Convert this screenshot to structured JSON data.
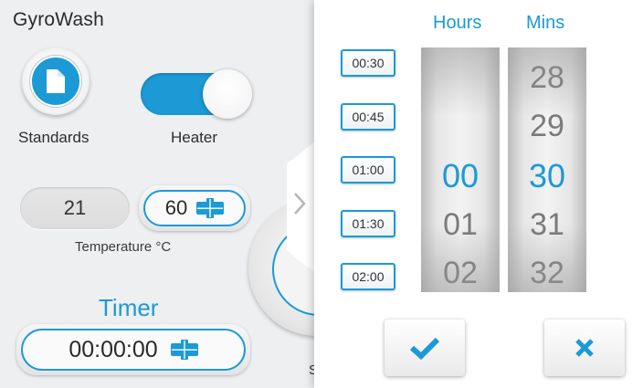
{
  "app": {
    "title": "GyroWash"
  },
  "standards": {
    "label": "Standards"
  },
  "heater": {
    "label": "Heater",
    "state": "on"
  },
  "temperature": {
    "current": "21",
    "setpoint": "60",
    "label": "Temperature °C"
  },
  "timer": {
    "label": "Timer",
    "value": "00:00:00"
  },
  "start_partial_label": "S",
  "picker": {
    "hours_header": "Hours",
    "mins_header": "Mins",
    "presets": [
      "00:30",
      "00:45",
      "01:00",
      "01:30",
      "02:00"
    ],
    "hours": {
      "prev": "",
      "selected": "00",
      "next": "01",
      "next2": "02"
    },
    "mins": {
      "prev2": "28",
      "prev": "29",
      "selected": "30",
      "next": "31",
      "next2": "32"
    }
  },
  "colors": {
    "accent": "#1b9ad6",
    "background": "#eeeff1",
    "panel": "#ffffff"
  },
  "icons": {
    "standards": "document-icon",
    "stepper": "plus-minus-stepper-icon",
    "confirm": "check-icon",
    "cancel": "close-icon",
    "panel_toggle": "chevron-right-icon"
  }
}
